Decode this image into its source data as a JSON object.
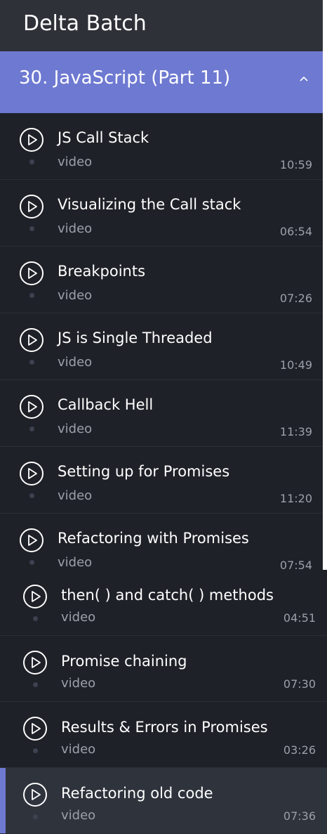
{
  "header": {
    "title": "Delta Batch"
  },
  "section": {
    "title": "30. JavaScript (Part 11)",
    "expanded": true,
    "accent_color": "#6e79d1"
  },
  "lectures": [
    {
      "title": "JS Call Stack",
      "type": "video",
      "duration": "10:59"
    },
    {
      "title": "Visualizing the Call stack",
      "type": "video",
      "duration": "06:54"
    },
    {
      "title": "Breakpoints",
      "type": "video",
      "duration": "07:26"
    },
    {
      "title": "JS is Single Threaded",
      "type": "video",
      "duration": "10:49"
    },
    {
      "title": "Callback Hell",
      "type": "video",
      "duration": "11:39"
    },
    {
      "title": "Setting up for Promises",
      "type": "video",
      "duration": "11:20"
    },
    {
      "title": "Refactoring with Promises",
      "type": "video",
      "duration": "07:54"
    },
    {
      "title": "then( ) and catch( ) methods",
      "type": "video",
      "duration": "04:51"
    },
    {
      "title": "Promise chaining",
      "type": "video",
      "duration": "07:30"
    },
    {
      "title": "Results & Errors in Promises",
      "type": "video",
      "duration": "03:26"
    },
    {
      "title": "Refactoring old code",
      "type": "video",
      "duration": "07:36",
      "active": true
    }
  ],
  "icons": {
    "play": "play-circle-icon",
    "collapse": "chevron-up-icon"
  }
}
